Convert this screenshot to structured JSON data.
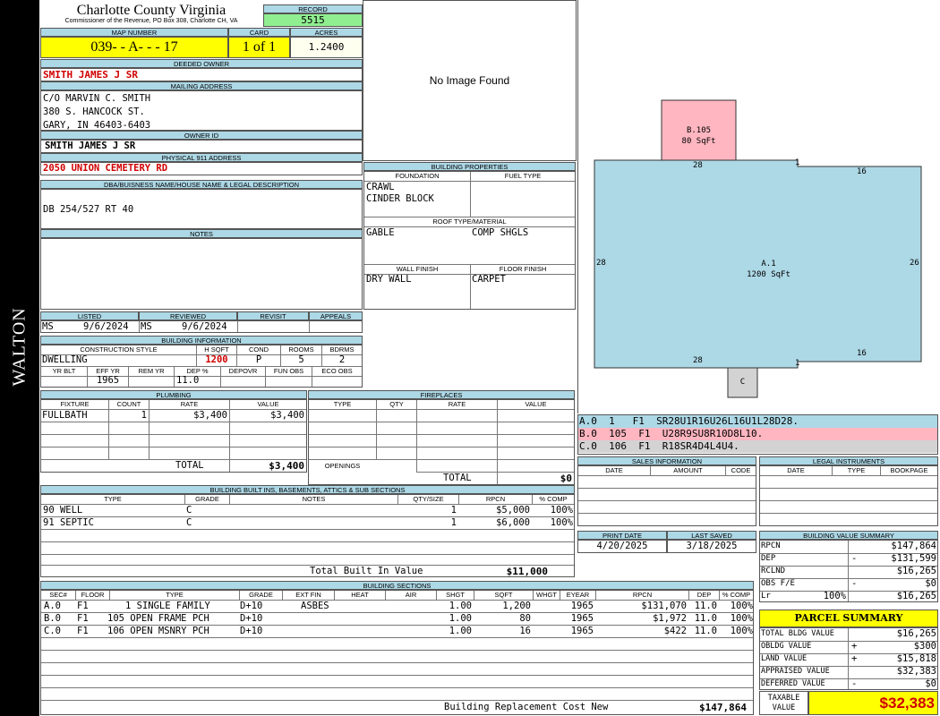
{
  "sidebar": {
    "name": "WALTON"
  },
  "header": {
    "county": "Charlotte County Virginia",
    "subtitle": "Commissioner of the Revenue, PO Box 308, Charlotte CH, VA",
    "record_label": "RECORD",
    "record": "5515",
    "map_label": "MAP NUMBER",
    "map": "039- - A- - - 17",
    "card_label": "CARD",
    "card": "1 of 1",
    "acres_label": "ACRES",
    "acres": "1.2400"
  },
  "owner": {
    "deeded_label": "DEEDED OWNER",
    "deeded": "SMITH JAMES J SR",
    "mailing_label": "MAILING ADDRESS",
    "mail1": "C/O MARVIN C. SMITH",
    "mail2": "380 S. HANCOCK ST.",
    "mail3": "GARY, IN 46403-6403",
    "id_label": "OWNER ID",
    "id": "SMITH JAMES J SR",
    "addr_label": "PHYSICAL 911 ADDRESS",
    "addr": "2050 UNION CEMETERY RD",
    "dba_label": "DBA/BUISNESS NAME/HOUSE NAME & LEGAL DESCRIPTION",
    "dba": "DB 254/527 RT 40",
    "notes_label": "NOTES"
  },
  "photo": {
    "text": "No Image Found"
  },
  "props": {
    "title": "BUILDING PROPERTIES",
    "foundation_label": "FOUNDATION",
    "fuel_label": "FUEL TYPE",
    "f1": "CRAWL",
    "f2": "CINDER BLOCK",
    "roof_label": "ROOF TYPE/MATERIAL",
    "roof1": "GABLE",
    "roof2": "COMP SHGLS",
    "wall_label": "WALL FINISH",
    "floor_label": "FLOOR FINISH",
    "wall": "DRY WALL",
    "floor": "CARPET"
  },
  "review": {
    "listed_label": "LISTED",
    "reviewed_label": "REVIEWED",
    "revisit_label": "REVISIT",
    "appeals_label": "APPEALS",
    "listed_by": "MS",
    "listed_date": "9/6/2024",
    "reviewed_by": "MS",
    "reviewed_date": "9/6/2024"
  },
  "info": {
    "title": "BUILDING INFORMATION",
    "style_label": "CONSTRUCTION STYLE",
    "hsqft_label": "H SQFT",
    "cond_label": "COND",
    "rooms_label": "ROOMS",
    "bdrms_label": "BDRMS",
    "style": "DWELLING",
    "hsqft": "1200",
    "cond": "P",
    "rooms": "5",
    "bdrms": "2",
    "yrblt_label": "YR BLT",
    "effyr_label": "EFF YR",
    "remyr_label": "REM YR",
    "dep_label": "DEP %",
    "depovr_label": "DEPOVR",
    "funobs_label": "FUN OBS",
    "ecoobs_label": "ECO OBS",
    "effyr": "1965",
    "dep": "11.0"
  },
  "plumbing": {
    "title": "PLUMBING",
    "h": [
      "FIXTURE",
      "COUNT",
      "RATE",
      "VALUE"
    ],
    "fixture": "FULLBATH",
    "count": "1",
    "rate": "$3,400",
    "value": "$3,400",
    "total_label": "TOTAL",
    "total": "$3,400"
  },
  "fireplaces": {
    "title": "FIREPLACES",
    "h": [
      "TYPE",
      "QTY",
      "RATE",
      "VALUE"
    ],
    "openings": "OPENINGS",
    "total_label": "TOTAL",
    "total": "$0"
  },
  "builtins": {
    "title": "BUILDING BUILT INS, BASEMENTS, ATTICS & SUB SECTIONS",
    "h": [
      "TYPE",
      "GRADE",
      "NOTES",
      "QTY/SIZE",
      "RPCN",
      "% COMP"
    ],
    "rows": [
      {
        "type": "90 WELL",
        "grade": "C",
        "qty": "1",
        "rpcn": "$5,000",
        "comp": "100%"
      },
      {
        "type": "91 SEPTIC",
        "grade": "C",
        "qty": "1",
        "rpcn": "$6,000",
        "comp": "100%"
      }
    ],
    "total_label": "Total Built In Value",
    "total": "$11,000"
  },
  "sections": {
    "title": "BUILDING SECTIONS",
    "h": [
      "SEC#",
      "FLOOR",
      "TYPE",
      "GRADE",
      "EXT FIN",
      "HEAT",
      "AIR",
      "SHGT",
      "SQFT",
      "WHGT",
      "EYEAR",
      "RPCN",
      "DEP",
      "% COMP"
    ],
    "rows": [
      {
        "sec": "A.0",
        "floor": "F1",
        "type": "1 SINGLE FAMILY",
        "grade": "D+10",
        "ext": "ASBES",
        "shgt": "1.00",
        "sqft": "1,200",
        "eyear": "1965",
        "rpcn": "$131,070",
        "dep": "11.0",
        "comp": "100%"
      },
      {
        "sec": "B.0",
        "floor": "F1",
        "type": "105 OPEN FRAME PCH",
        "grade": "D+10",
        "ext": "",
        "shgt": "1.00",
        "sqft": "80",
        "eyear": "1965",
        "rpcn": "$1,972",
        "dep": "11.0",
        "comp": "100%"
      },
      {
        "sec": "C.0",
        "floor": "F1",
        "type": "106 OPEN MSNRY PCH",
        "grade": "D+10",
        "ext": "",
        "shgt": "1.00",
        "sqft": "16",
        "eyear": "1965",
        "rpcn": "$422",
        "dep": "11.0",
        "comp": "100%"
      }
    ],
    "total_label": "Building Replacement Cost New",
    "total": "$147,864"
  },
  "sketch": {
    "b_label": "B.105",
    "b_area": "80 SqFt",
    "a_label": "A.1",
    "a_area": "1200 SqFt",
    "c_label": "C",
    "d28a": "28",
    "d1a": "1",
    "d16a": "16",
    "d28l": "28",
    "d26": "26",
    "d28b": "28",
    "d1b": "1",
    "d16b": "16"
  },
  "legend": [
    {
      "text": "A.0  1   F1  SR28U1R16U26L16U1L28D28.",
      "color": "#add8e6"
    },
    {
      "text": "B.0  105  F1  U28R9SU8R10D8L10.",
      "color": "#ffb6c1"
    },
    {
      "text": "C.0  106  F1  R18SR4D4L4U4.",
      "color": "#d3d3d3"
    }
  ],
  "sales": {
    "title": "SALES INFORMATION",
    "h": [
      "DATE",
      "AMOUNT",
      "CODE"
    ]
  },
  "legal": {
    "title": "LEGAL INSTRUMENTS",
    "h": [
      "DATE",
      "TYPE",
      "BOOKPAGE"
    ]
  },
  "dates": {
    "print_label": "PRINT DATE",
    "saved_label": "LAST SAVED",
    "print": "4/20/2025",
    "saved": "3/18/2025"
  },
  "bvs": {
    "title": "BUILDING VALUE SUMMARY",
    "rpcn_label": "RPCN",
    "rpcn": "$147,864",
    "dep_label": "DEP",
    "dep_sign": "-",
    "dep": "$131,599",
    "rclnd_label": "RCLND",
    "rclnd": "$16,265",
    "obs_label": "OBS F/E",
    "obs_sign": "-",
    "obs": "$0",
    "lr_label": "Lr",
    "lr_pct": "100%",
    "lr": "$16,265"
  },
  "parcel": {
    "title": "PARCEL SUMMARY",
    "tbv_label": "TOTAL BLDG VALUE",
    "tbv": "$16,265",
    "obldg_label": "OBLDG VALUE",
    "obldg_sign": "+",
    "obldg": "$300",
    "land_label": "LAND VALUE",
    "land_sign": "+",
    "land": "$15,818",
    "appr_label": "APPRAISED VALUE",
    "appr": "$32,383",
    "def_label": "DEFERRED VALUE",
    "def_sign": "-",
    "def": "$0",
    "tax_label1": "TAXABLE",
    "tax_label2": "VALUE",
    "tax": "$32,383"
  }
}
